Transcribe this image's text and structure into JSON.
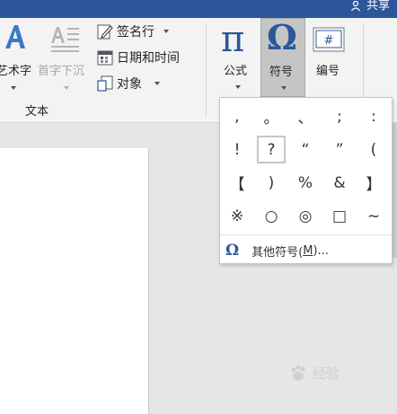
{
  "titlebar": {
    "share_label": "共享"
  },
  "ribbon": {
    "wordart_label": "艺术字",
    "dropcap_label": "首字下沉",
    "signature_label": "签名行",
    "datetime_label": "日期和时间",
    "object_label": "对象",
    "group_text_label": "文本",
    "equation_label": "公式",
    "symbol_label": "符号",
    "number_label": "编号",
    "equation_glyph": "π",
    "symbol_glyph": "Ω",
    "number_glyph": "#"
  },
  "symbol_popup": {
    "symbols": [
      ",",
      "。",
      "、",
      ";",
      ":",
      "!",
      "?",
      "“",
      "”",
      "(",
      "【",
      ")",
      "%",
      "&",
      "】",
      "※",
      "○",
      "◎",
      "□",
      "~"
    ],
    "selected_symbol": "?",
    "more_symbols_label": "其他符号(",
    "more_symbols_key": "M",
    "more_symbols_suffix": ")...",
    "more_icon": "Ω"
  },
  "watermark": {
    "text": "经验"
  },
  "colors": {
    "accent": "#2b579a",
    "selected_btn": "#c5c5c5"
  }
}
